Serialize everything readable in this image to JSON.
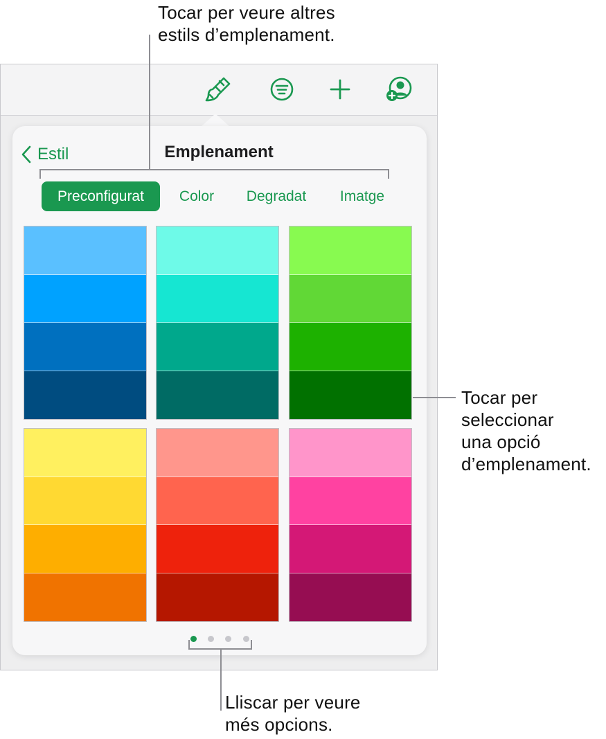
{
  "callouts": {
    "top": "Tocar per veure altres\nestils d’emplenament.",
    "right": "Tocar per\nseleccionar\nuna opció\nd’emplenament.",
    "bottom": "Lliscar per veure\nmés opcions."
  },
  "toolbar": {
    "icons": [
      "paintbrush-icon",
      "format-icon",
      "add-icon",
      "collaborate-icon"
    ]
  },
  "popover": {
    "back_label": "Estil",
    "title": "Emplenament",
    "tabs": [
      {
        "label": "Preconfigurat",
        "active": true
      },
      {
        "label": "Color",
        "active": false
      },
      {
        "label": "Degradat",
        "active": false
      },
      {
        "label": "Imatge",
        "active": false
      }
    ],
    "swatches": [
      [
        "#5ac0ff",
        "#00a2ff",
        "#0070bf",
        "#004c80"
      ],
      [
        "#6efae8",
        "#16e6d2",
        "#00a88c",
        "#006b64"
      ],
      [
        "#88fa50",
        "#61d836",
        "#1db100",
        "#017100"
      ],
      [
        "#fff05f",
        "#ffd932",
        "#feae00",
        "#f07300"
      ],
      [
        "#ff968c",
        "#ff644e",
        "#ee220c",
        "#b51700"
      ],
      [
        "#ff95ca",
        "#ff42a1",
        "#d41876",
        "#960d52"
      ]
    ],
    "page_dots": {
      "count": 4,
      "active": 0
    }
  },
  "colors": {
    "accent": "#1a9850"
  }
}
